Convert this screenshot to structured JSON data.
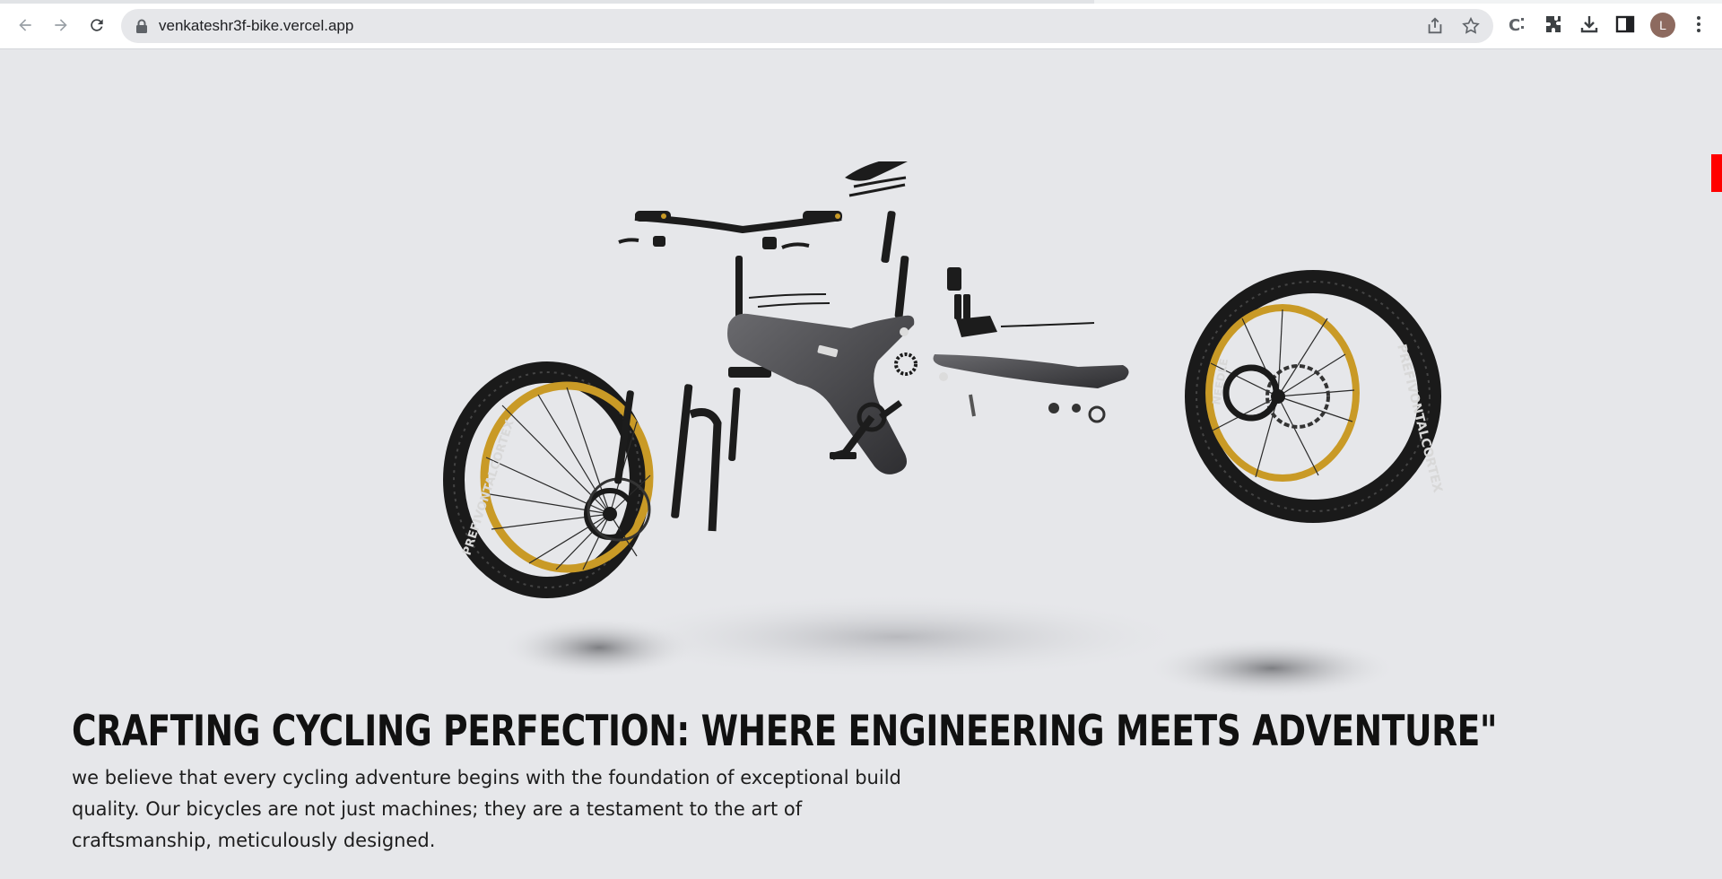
{
  "browser": {
    "url": "venkateshr3f-bike.vercel.app",
    "profile_initial": "L",
    "toolbar_icons": [
      "back-icon",
      "forward-icon",
      "reload-icon",
      "lock-icon",
      "share-icon",
      "star-icon",
      "extension-c-icon",
      "puzzle-icon",
      "download-icon",
      "side-panel-icon",
      "menu-icon"
    ]
  },
  "hero": {
    "headline": "CRAFTING CYCLING PERFECTION: WHERE ENGINEERING MEETS ADVENTURE\"",
    "description": "we believe that every cycling adventure begins with the foundation of exceptional build quality. Our bicycles are not just machines; they are a testament to the art of craftsmanship, meticulously designed.",
    "tire_brand": "PREFIVONTALCORTEX",
    "tire_label": "NEEDLE"
  },
  "colors": {
    "background": "#e6e7ea",
    "rim": "#c99a26",
    "tire": "#1a1a1a",
    "frame": "#4a4a4c",
    "scroll_marker": "#ff0000"
  }
}
